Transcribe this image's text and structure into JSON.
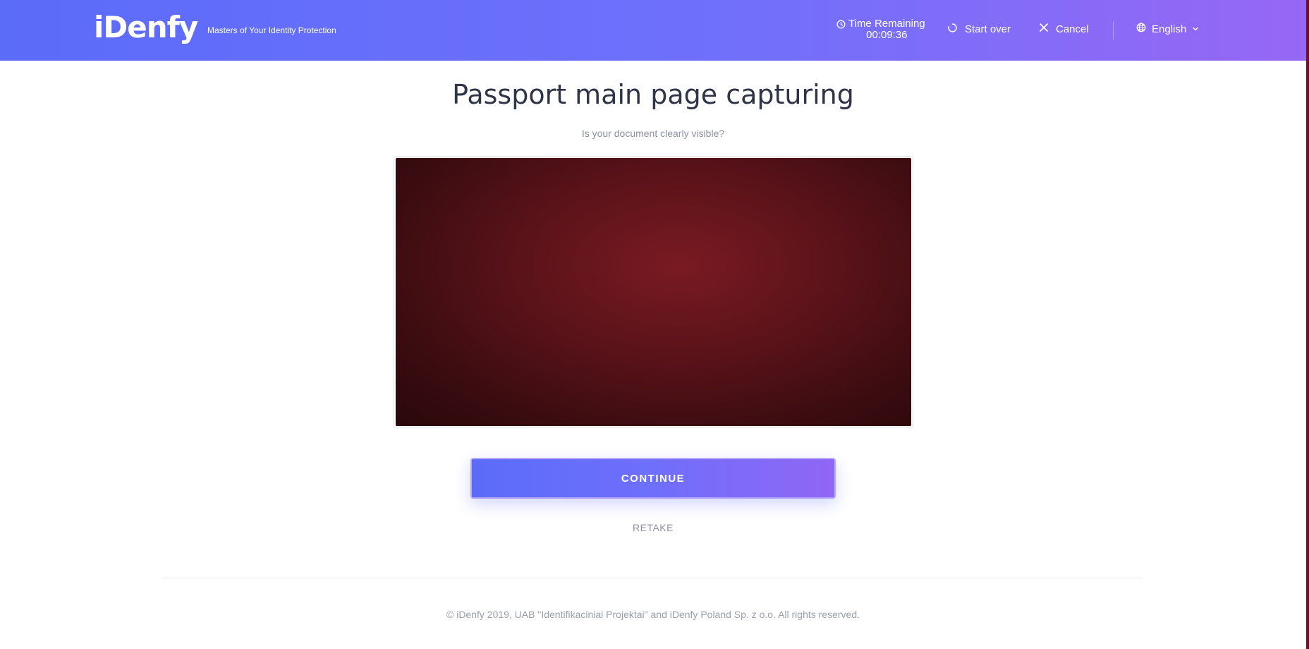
{
  "header": {
    "logo_text": "iDenfy",
    "tagline": "Masters of Your Identity Protection",
    "timer": {
      "label": "Time Remaining",
      "value": "00:09:36",
      "icon": "clock-icon"
    },
    "start_over": {
      "label": "Start over",
      "icon": "refresh-icon"
    },
    "cancel": {
      "label": "Cancel",
      "icon": "close-icon"
    },
    "language": {
      "label": "English",
      "icon": "globe-icon",
      "chevron": "chevron-down-icon"
    }
  },
  "main": {
    "title": "Passport main page capturing",
    "subtitle": "Is your document clearly visible?",
    "continue_label": "CONTINUE",
    "retake_label": "RETAKE"
  },
  "footer": {
    "copyright": "© iDenfy 2019, UAB \"Identifikaciniai Projektai\" and iDenfy Poland Sp. z o.o. All rights reserved."
  },
  "colors": {
    "header_gradient_start": "#5b6cf9",
    "header_gradient_end": "#9767f5",
    "preview_dark_red": "#5a1319"
  }
}
